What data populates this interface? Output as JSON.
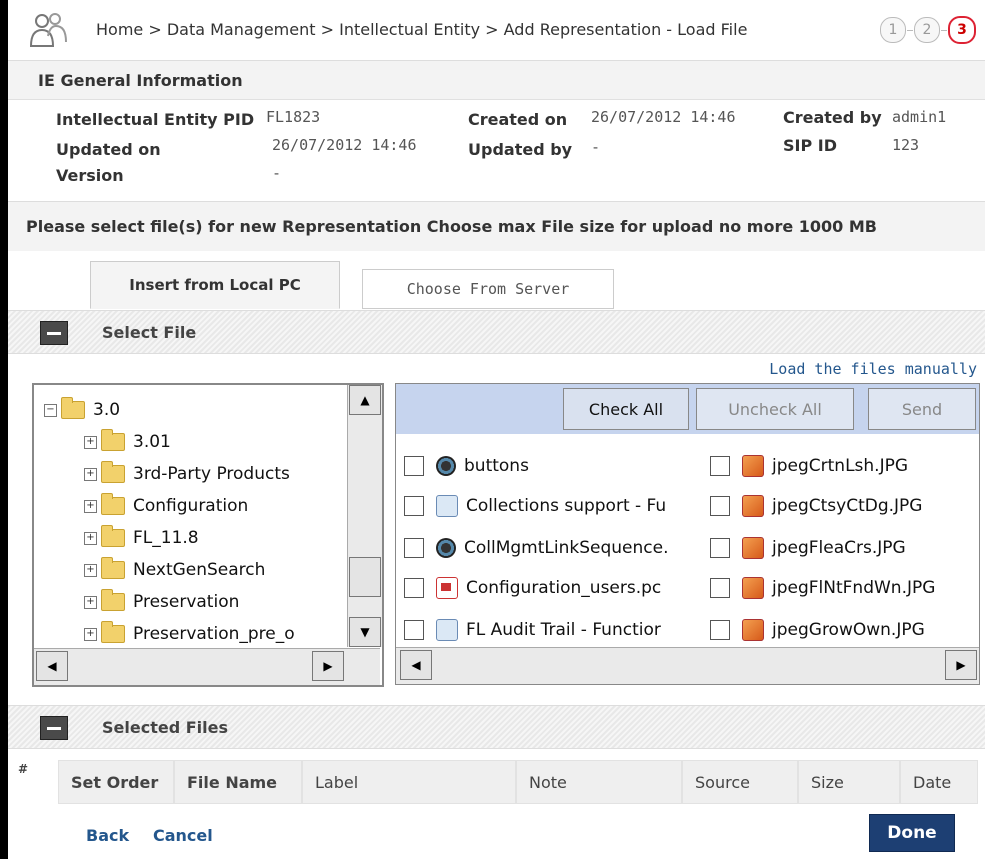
{
  "header": {
    "breadcrumb": "Home > Data Management > Intellectual Entity > Add Representation - Load File",
    "steps": [
      "1",
      "2",
      "3"
    ]
  },
  "ie_section": {
    "title": "IE General Information",
    "fields": {
      "pid_label": "Intellectual Entity PID",
      "pid_value": "FL1823",
      "created_on_label": "Created on",
      "created_on_value": "26/07/2012 14:46",
      "created_by_label": "Created by",
      "created_by_value": "admin1",
      "updated_on_label": "Updated on",
      "updated_on_value": "26/07/2012 14:46",
      "updated_by_label": "Updated by",
      "updated_by_value": "-",
      "sip_label": "SIP ID",
      "sip_value": "123",
      "version_label": "Version",
      "version_value": "-"
    }
  },
  "instruction": "Please select file(s) for new Representation Choose max File size for upload no more 1000 MB",
  "tabs": [
    {
      "label": "Insert from Local PC",
      "active": true
    },
    {
      "label": "Choose From Server",
      "active": false
    }
  ],
  "select_file": {
    "title": "Select File",
    "load_manually": "Load the files manually",
    "tree": [
      {
        "label": "3.0",
        "toggle": "−",
        "level": 0
      },
      {
        "label": "3.01",
        "toggle": "+",
        "level": 1
      },
      {
        "label": "3rd-Party Products",
        "toggle": "+",
        "level": 1
      },
      {
        "label": "Configuration",
        "toggle": "+",
        "level": 1
      },
      {
        "label": "FL_11.8",
        "toggle": "+",
        "level": 1
      },
      {
        "label": "NextGenSearch",
        "toggle": "+",
        "level": 1
      },
      {
        "label": "Preservation",
        "toggle": "+",
        "level": 1
      },
      {
        "label": "Preservation_pre_o",
        "toggle": "+",
        "level": 1
      }
    ],
    "toolbar": {
      "check_all": "Check All",
      "uncheck_all": "Uncheck All",
      "send": "Send"
    },
    "files_left": [
      {
        "name": "buttons",
        "icon": "gear-icon"
      },
      {
        "name": "Collections support - Fu",
        "icon": "doc-icon"
      },
      {
        "name": "CollMgmtLinkSequence.",
        "icon": "gear-icon"
      },
      {
        "name": "Configuration_users.pc",
        "icon": "pdf-icon"
      },
      {
        "name": "FL Audit Trail - Functior",
        "icon": "doc-icon"
      }
    ],
    "files_right": [
      {
        "name": "jpegCrtnLsh.JPG",
        "icon": "jpg-icon"
      },
      {
        "name": "jpegCtsyCtDg.JPG",
        "icon": "jpg-icon"
      },
      {
        "name": "jpegFleaCrs.JPG",
        "icon": "jpg-icon"
      },
      {
        "name": "jpegFlNtFndWn.JPG",
        "icon": "jpg-icon"
      },
      {
        "name": "jpegGrowOwn.JPG",
        "icon": "jpg-icon"
      }
    ]
  },
  "selected_files": {
    "title": "Selected Files",
    "hash": "#",
    "columns": [
      "Set Order",
      "File Name",
      "Label",
      "Note",
      "Source",
      "Size",
      "Date"
    ]
  },
  "footer": {
    "back": "Back",
    "cancel": "Cancel",
    "done": "Done"
  }
}
